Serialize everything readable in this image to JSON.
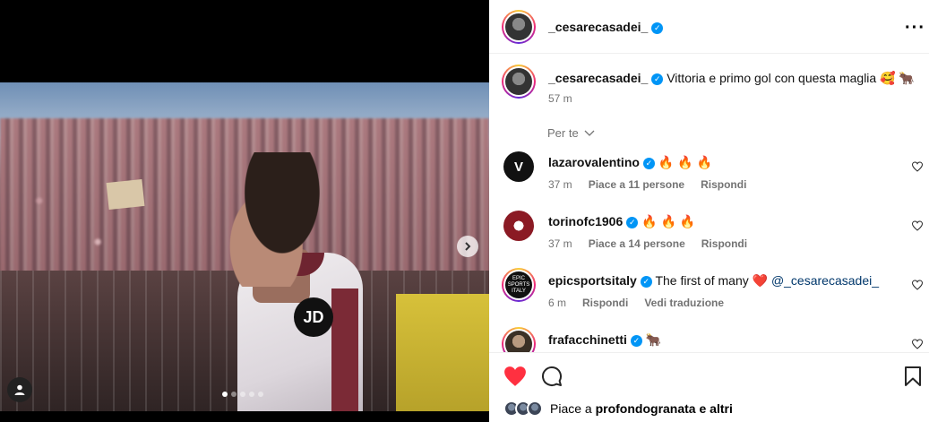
{
  "post": {
    "author": "_cesarecasadei_",
    "caption": "Vittoria e primo gol con questa maglia",
    "caption_emoji": "🥰 🐂",
    "time": "57 m",
    "media": {
      "badge_text": "JD",
      "carousel_count": 5,
      "carousel_active_index": 0
    }
  },
  "sort_label": "Per te",
  "comments": [
    {
      "user": "lazarovalentino",
      "text": "🔥 🔥 🔥",
      "time": "37 m",
      "likes": "Piace a 11 persone",
      "reply": "Rispondi",
      "avatar_text": "V"
    },
    {
      "user": "torinofc1906",
      "text": "🔥 🔥 🔥",
      "time": "37 m",
      "likes": "Piace a 14 persone",
      "reply": "Rispondi",
      "avatar_text": ""
    },
    {
      "user": "epicsportsitaly",
      "text": "The first of many ❤️",
      "mention": "@_cesarecasadei_",
      "time": "6 m",
      "reply": "Rispondi",
      "translate": "Vedi traduzione",
      "avatar_text": "EPIC SPORTS ITALY"
    },
    {
      "user": "frafacchinetti",
      "text": "🐂",
      "avatar_text": ""
    }
  ],
  "likes_bar": {
    "prefix": "Piace a",
    "user": "profondogranata",
    "suffix": "e altri"
  },
  "colors": {
    "verified": "#0095f6",
    "like_red": "#ff3040",
    "muted_text": "#737373"
  },
  "icons": {
    "verified": "verified-badge-icon",
    "more": "more-options-icon",
    "like": "heart-icon",
    "comment": "comment-icon",
    "save": "bookmark-icon",
    "next": "chevron-right-icon",
    "tag": "user-tag-icon"
  }
}
